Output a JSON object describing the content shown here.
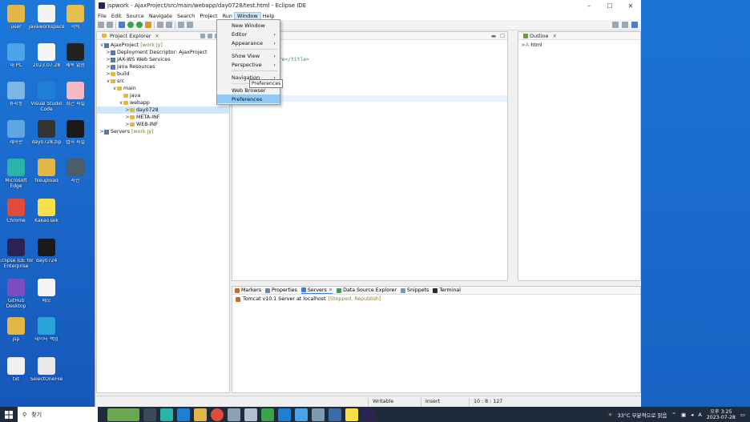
{
  "window": {
    "title": "jspwork - AjaxProject/src/main/webapp/day0728/test.html - Eclipse IDE",
    "controls": [
      "–",
      "☐",
      "✕"
    ]
  },
  "menubar": [
    "File",
    "Edit",
    "Source",
    "Navigate",
    "Search",
    "Project",
    "Run",
    "Window",
    "Help"
  ],
  "window_menu": {
    "items": [
      "New Window",
      "Editor",
      "Appearance",
      "Show View",
      "Perspective",
      "Navigation",
      "Web Browser",
      "Preferences"
    ],
    "selected": "Preferences",
    "tooltip": "Preferences"
  },
  "project_explorer": {
    "title": "Project Explorer",
    "tree": [
      {
        "label": "AjaxProject",
        "tag": "[work jy]",
        "arrow": "∨",
        "depth": 0,
        "kind": "project"
      },
      {
        "label": "Deployment Descriptor: AjaxProject",
        "arrow": ">",
        "depth": 1,
        "kind": "config"
      },
      {
        "label": "JAX-WS Web Services",
        "arrow": ">",
        "depth": 1,
        "kind": "config"
      },
      {
        "label": "Java Resources",
        "arrow": ">",
        "depth": 1,
        "kind": "config"
      },
      {
        "label": "build",
        "arrow": ">",
        "depth": 1,
        "kind": "folder"
      },
      {
        "label": "src",
        "arrow": "∨",
        "depth": 1,
        "kind": "folder"
      },
      {
        "label": "main",
        "arrow": "∨",
        "depth": 2,
        "kind": "folder"
      },
      {
        "label": "java",
        "arrow": "",
        "depth": 3,
        "kind": "folder"
      },
      {
        "label": "webapp",
        "arrow": "∨",
        "depth": 3,
        "kind": "folder"
      },
      {
        "label": "day0728",
        "arrow": ">",
        "depth": 4,
        "kind": "folder",
        "selected": true
      },
      {
        "label": "META-INF",
        "arrow": ">",
        "depth": 4,
        "kind": "folder"
      },
      {
        "label": "WEB-INF",
        "arrow": ">",
        "depth": 4,
        "kind": "folder"
      },
      {
        "label": "Servers",
        "tag": "[work jy]",
        "arrow": ">",
        "depth": 0,
        "kind": "project"
      }
    ]
  },
  "editor": {
    "lines": [
      {
        "pre": "",
        "text": "al>",
        "cls": "tagc"
      },
      {
        "pre": "",
        "text": "",
        "cls": ""
      },
      {
        "pre": "",
        "text": "=\"EUC-KR\">",
        "cls": "kw"
      },
      {
        "pre": "",
        "text": "t title here</title>",
        "cls": "tagc"
      }
    ],
    "highlighted_line": 8
  },
  "outline": {
    "title": "Outline",
    "items": [
      "html"
    ]
  },
  "console": {
    "tabs": [
      "Markers",
      "Properties",
      "Servers",
      "Data Source Explorer",
      "Snippets",
      "Terminal"
    ],
    "active_tab": "Servers",
    "server": "Tomcat v10.1 Server at localhost",
    "server_status": "[Stopped, Republish]"
  },
  "statusbar": {
    "mode": "Writable",
    "insert": "Insert",
    "position": "10 : 8 : 127"
  },
  "desktop_icons": [
    {
      "label": "user",
      "color": "#e2b646"
    },
    {
      "label": "javaworkspace",
      "color": "#f2f2f2"
    },
    {
      "label": "이력",
      "color": "#e6c04a"
    },
    {
      "label": "내 PC",
      "color": "#4ca3e8"
    },
    {
      "label": "2023.07.28",
      "color": "#f5f5f5"
    },
    {
      "label": "제목 없음",
      "color": "#222"
    },
    {
      "label": "휴지통",
      "color": "#7fb6e6"
    },
    {
      "label": "Visual Studio Code",
      "color": "#1f7fd6"
    },
    {
      "label": "최근 파일",
      "color": "#f3b9c4"
    },
    {
      "label": "제어판",
      "color": "#5fa5e0"
    },
    {
      "label": "day0728.zip",
      "color": "#333"
    },
    {
      "label": "캡처 파일",
      "color": "#1a1a1a"
    },
    {
      "label": "Microsoft Edge",
      "color": "#2ab3a8"
    },
    {
      "label": "fileupload",
      "color": "#e2b646"
    },
    {
      "label": "사진",
      "color": "#4b5c6b"
    },
    {
      "label": "Chrome",
      "color": "#e04b3c"
    },
    {
      "label": "KakaoTalk",
      "color": "#f8e04b"
    },
    {
      "label": "Eclipse IDE for Enterprise",
      "color": "#2c2255"
    },
    {
      "label": "day0724",
      "color": "#1a1a1a"
    },
    {
      "label": "GitHub Desktop",
      "color": "#7c4dbe"
    },
    {
      "label": "메모",
      "color": "#f5f5f5"
    },
    {
      "label": "jsp",
      "color": "#e2b646"
    },
    {
      "label": "데이터 백업",
      "color": "#2aa3d8"
    },
    {
      "label": "txt",
      "color": "#f0f0f0"
    },
    {
      "label": "SelectOneFile",
      "color": "#e8e8e8"
    }
  ],
  "taskbar": {
    "search_placeholder": "찾기",
    "weather": "33°C 부분적으로 맑음",
    "time": "오후 3:25",
    "date": "2023-07-28",
    "lang": "A"
  },
  "colors": {
    "selection": "#cce8ff",
    "menu_highlight": "#90c8f6",
    "desktop": "#1b6dd1",
    "taskbar": "#1f2a3a"
  }
}
